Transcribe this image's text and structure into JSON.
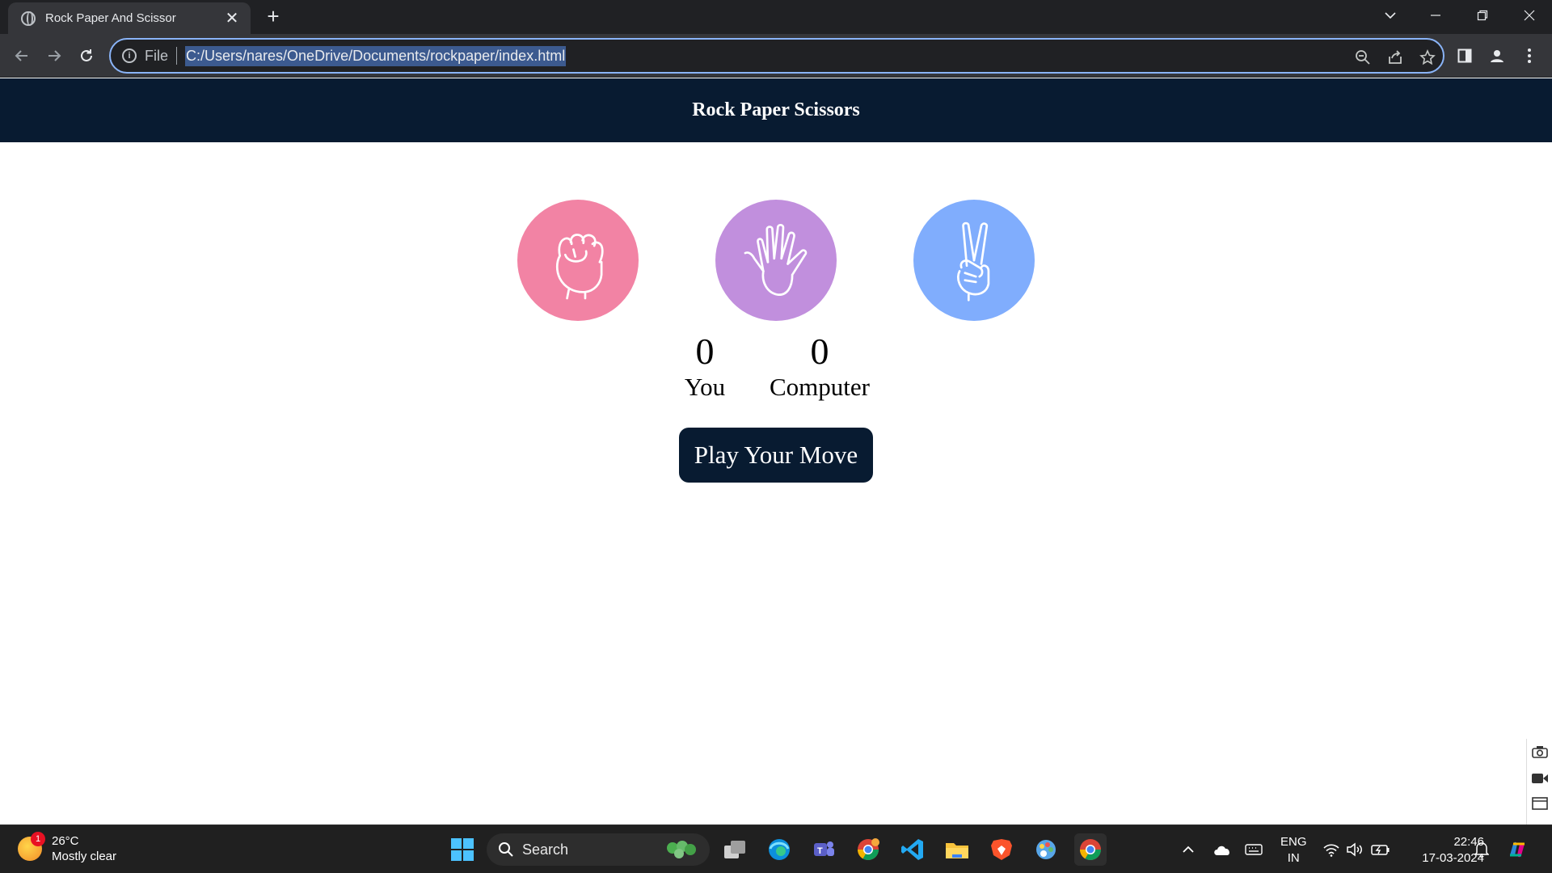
{
  "browser": {
    "tab_title": "Rock Paper And Scissor",
    "tab_close": "✕",
    "new_tab": "+",
    "omnibox_label": "File",
    "url": "C:/Users/nares/OneDrive/Documents/rockpaper/index.html",
    "icons": [
      "back-icon",
      "forward-icon",
      "reload-icon",
      "info-icon",
      "zoom-icon",
      "share-icon",
      "bookmark-star-icon",
      "side-panel-icon",
      "profile-icon",
      "menu-icon"
    ]
  },
  "page": {
    "header_title": "Rock Paper Scissors",
    "choices": [
      {
        "id": "rock",
        "icon": "fist-icon",
        "color": "#f283a4"
      },
      {
        "id": "paper",
        "icon": "open-hand-icon",
        "color": "#c18fdd"
      },
      {
        "id": "scissors",
        "icon": "peace-hand-icon",
        "color": "#80adfd"
      }
    ],
    "scores": {
      "user_score": "0",
      "user_label": "You",
      "computer_score": "0",
      "computer_label": "Computer"
    },
    "message_button": "Play Your Move",
    "colors": {
      "header_bg": "#081b31",
      "button_bg": "#081b31"
    }
  },
  "taskbar": {
    "weather_temp": "26°C",
    "weather_desc": "Mostly clear",
    "weather_badge": "1",
    "search_label": "Search",
    "lang_primary": "ENG",
    "lang_secondary": "IN",
    "time": "22:46",
    "date": "17-03-2024"
  }
}
